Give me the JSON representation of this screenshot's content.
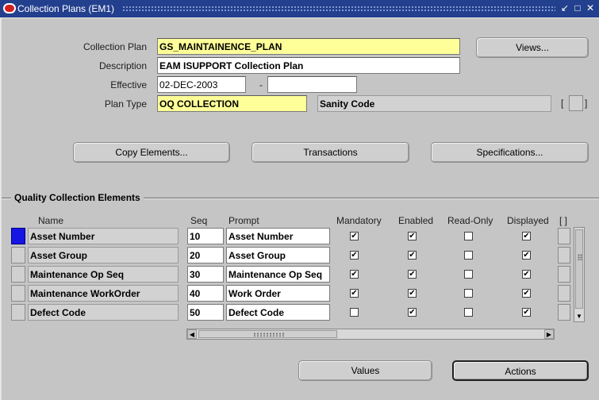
{
  "window": {
    "title": "Collection Plans (EM1)",
    "controls": [
      "minimize-icon",
      "maximize-icon",
      "close-icon"
    ]
  },
  "header": {
    "collection_plan_label": "Collection Plan",
    "collection_plan_value": "GS_MAINTAINENCE_PLAN",
    "description_label": "Description",
    "description_value": "EAM ISUPPORT Collection Plan",
    "effective_label": "Effective",
    "effective_from": "02-DEC-2003",
    "effective_sep": "-",
    "effective_to": "",
    "plan_type_label": "Plan Type",
    "plan_type_value": "OQ COLLECTION",
    "plan_type_desc": "Sanity Code",
    "views_button": "Views...",
    "flex_open": "[",
    "flex_close": "]"
  },
  "buttons": {
    "copy_elements": "Copy Elements...",
    "transactions": "Transactions",
    "specifications": "Specifications...",
    "values": "Values",
    "actions": "Actions"
  },
  "section": {
    "title": "Quality Collection Elements"
  },
  "columns": {
    "name": "Name",
    "seq": "Seq",
    "prompt": "Prompt",
    "mandatory": "Mandatory",
    "enabled": "Enabled",
    "read_only": "Read-Only",
    "displayed": "Displayed",
    "flex": "[ ]"
  },
  "elements": [
    {
      "name": "Asset Number",
      "seq": "10",
      "prompt": "Asset Number",
      "mandatory": true,
      "enabled": true,
      "read_only": false,
      "displayed": true
    },
    {
      "name": "Asset Group",
      "seq": "20",
      "prompt": "Asset Group",
      "mandatory": true,
      "enabled": true,
      "read_only": false,
      "displayed": true
    },
    {
      "name": "Maintenance Op Seq",
      "seq": "30",
      "prompt": "Maintenance Op Seq",
      "mandatory": true,
      "enabled": true,
      "read_only": false,
      "displayed": true
    },
    {
      "name": "Maintenance WorkOrder",
      "seq": "40",
      "prompt": "Work Order",
      "mandatory": true,
      "enabled": true,
      "read_only": false,
      "displayed": true
    },
    {
      "name": "Defect Code",
      "seq": "50",
      "prompt": "Defect Code",
      "mandatory": false,
      "enabled": true,
      "read_only": false,
      "displayed": true
    }
  ],
  "colors": {
    "titlebar": "#23408e",
    "required_field": "#ffff99",
    "current_row": "#1515e6"
  }
}
